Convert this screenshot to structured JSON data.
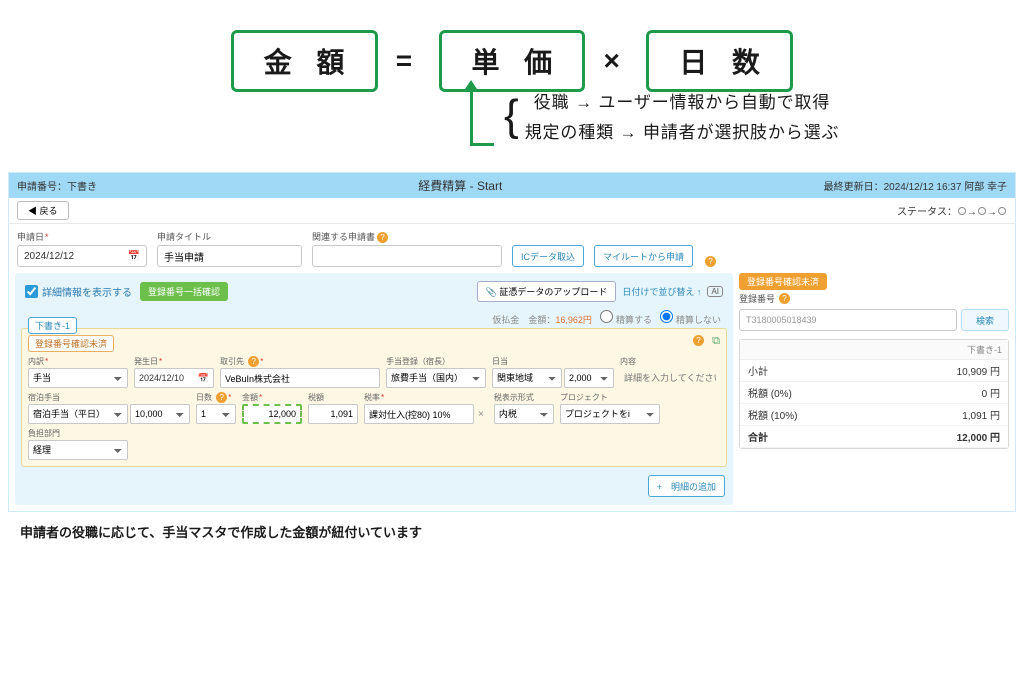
{
  "formula": {
    "amount": "金 額",
    "unit": "単 価",
    "days": "日 数",
    "eq": "=",
    "mul": "×"
  },
  "annot": {
    "line1": "役職 → ユーザー情報から自動で取得",
    "line2": "規定の種類 → 申請者が選択肢から選ぶ"
  },
  "header": {
    "left_label": "申請番号：",
    "left_val": "下書き",
    "center": "経費精算 - Start",
    "right_label": "最終更新日：",
    "right_val": "2024/12/12 16:37 阿部 幸子"
  },
  "nav": {
    "back": "◀ 戻る",
    "status_label": "ステータス：",
    "arrow": "→"
  },
  "form": {
    "date_label": "申請日",
    "date_val": "2024/12/12",
    "cal_icon": "📅",
    "title_label": "申請タイトル",
    "title_val": "手当申請",
    "rel_label": "関連する申請書",
    "rel_val": "",
    "ic_btn": "ICデータ取込",
    "route_btn": "マイルートから申請"
  },
  "detail": {
    "show_detail": "詳細情報を表示する",
    "batch_btn": "登録番号一括確認",
    "upload": "証憑データのアップロード",
    "clip": "📎",
    "sort": "日付けで並び替え ↑",
    "ai": "AI",
    "balance_lbl": "仮払金　金額：",
    "balance_val": "16,962円",
    "settle_yes": "精算する",
    "settle_no": "精算しない"
  },
  "card": {
    "tab": "下書き-1",
    "unchecked": "登録番号確認未済",
    "labels": {
      "breakdown": "内訳",
      "date": "発生日",
      "supplier": "取引先",
      "allow": "手当登録（宿長）",
      "perdiem": "日当",
      "content": "内容",
      "stay": "宿泊手当",
      "days": "日数",
      "amount": "金額",
      "tax": "税額",
      "taxrate": "税率",
      "taxdisp": "税表示形式",
      "project": "プロジェクト",
      "dept": "負担部門"
    },
    "vals": {
      "breakdown": "手当",
      "date": "2024/12/10",
      "cal": "📅",
      "supplier": "VeBuIn株式会社",
      "allow": "旅費手当（国内）",
      "perdiem": "関東地域",
      "perdiem_amt": "2,000",
      "content_ph": "詳細を入力してください",
      "stay": "宿泊手当（平日）",
      "stay_amt": "10,000",
      "days": "1",
      "amount": "12,000",
      "tax": "1,091",
      "taxrate": "課対仕入(控80) 10%",
      "taxdisp": "内税",
      "project": "プロジェクトをi",
      "dept": "経理"
    },
    "add_btn": "+　明細の追加"
  },
  "right": {
    "badge": "登録番号確認未済",
    "label": "登録番号",
    "val": "T3180005018439",
    "search": "検索",
    "sum_hdr": "下書き-1",
    "rows": [
      {
        "l": "小計",
        "v": "10,909 円"
      },
      {
        "l": "税額 (0%)",
        "v": "0 円"
      },
      {
        "l": "税額 (10%)",
        "v": "1,091 円"
      },
      {
        "l": "合計",
        "v": "12,000 円"
      }
    ]
  },
  "footnote": "申請者の役職に応じて、手当マスタで作成した金額が紐付いています"
}
